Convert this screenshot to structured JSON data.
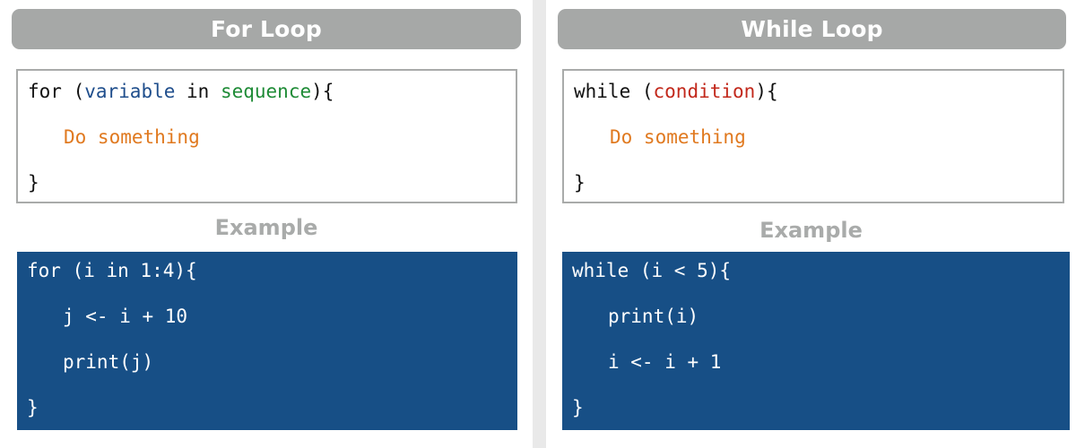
{
  "for_panel": {
    "title": "For Loop",
    "syntax": {
      "line1": {
        "keyword": "for",
        "open_paren": " (",
        "variable": "variable",
        "in": " in ",
        "sequence": "sequence",
        "close": "){"
      },
      "line2": "Do something",
      "line3": "}"
    },
    "example_label": "Example",
    "example_lines": [
      "for (i in 1:4){",
      "j <- i + 10",
      "print(j)",
      "}"
    ]
  },
  "while_panel": {
    "title": "While Loop",
    "syntax": {
      "line1": {
        "keyword": "while",
        "open_paren": " (",
        "condition": "condition",
        "close": "){"
      },
      "line2": "Do something",
      "line3": "}"
    },
    "example_label": "Example",
    "example_lines": [
      "while (i < 5){",
      "print(i)",
      "i <- i + 1",
      "}"
    ]
  },
  "colors": {
    "header_bg": "#a6a8a7",
    "example_bg": "#174f86",
    "variable": "#1f4e8c",
    "sequence": "#1e8b36",
    "condition": "#c2281b",
    "body_text": "#e0791f"
  }
}
